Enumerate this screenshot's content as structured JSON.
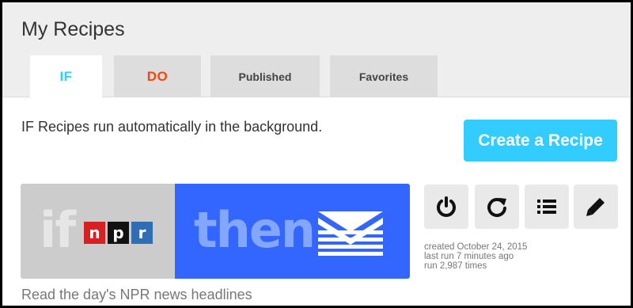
{
  "page": {
    "title": "My Recipes"
  },
  "tabs": [
    {
      "label": "IF",
      "color": "#33ccff",
      "active": true
    },
    {
      "label": "DO",
      "color": "#ff4400",
      "active": false
    },
    {
      "label": "Published",
      "active": false
    },
    {
      "label": "Favorites",
      "active": false
    }
  ],
  "intro_text": "IF Recipes run automatically in the background.",
  "create_button": {
    "label": "Create a Recipe",
    "color": "#33ccff"
  },
  "recipe": {
    "if_word": "if",
    "trigger_logo": {
      "letters": [
        "n",
        "p",
        "r"
      ],
      "name": "npr-logo"
    },
    "then_word": "then",
    "action_icon": "email-icon",
    "colors": {
      "left": "#cccccc",
      "right": "#3366ff"
    },
    "meta": {
      "created": "created October 24, 2015",
      "last_run": "last run 7 minutes ago",
      "run_count": "run 2,987 times"
    },
    "description": "Read the day's NPR news headlines",
    "actions": [
      "power-icon",
      "refresh-icon",
      "list-icon",
      "pencil-icon"
    ]
  }
}
